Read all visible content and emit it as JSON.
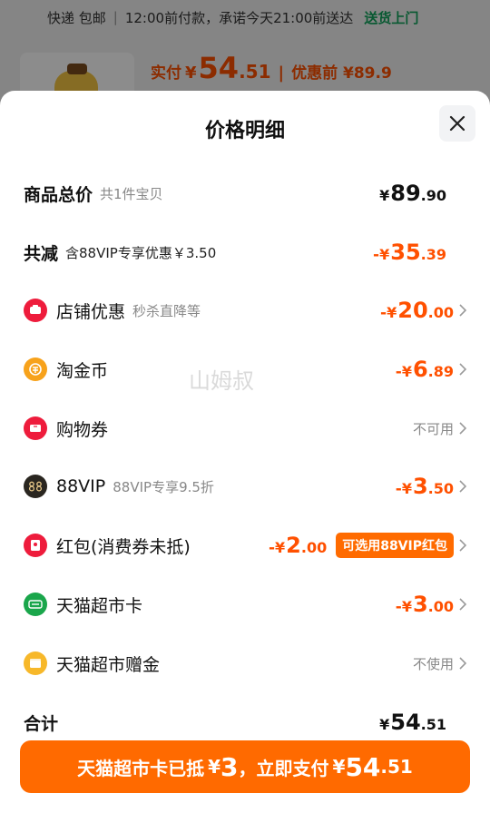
{
  "background": {
    "delivery_prefix": "快递 包邮",
    "delivery_info": "12:00前付款，承诺今天21:00前送达",
    "delivery_link": "送货上门",
    "paid_label": "实付",
    "paid_currency": "¥",
    "paid_int": "54",
    "paid_dec": ".51",
    "before_label": "优惠前 ¥89.9"
  },
  "sheet": {
    "title": "价格明细",
    "watermark": "山姆叔"
  },
  "rows": {
    "total": {
      "label": "商品总价",
      "sub": "共1件宝贝",
      "currency": "¥",
      "int": "89",
      "dec": ".90"
    },
    "reduce": {
      "label": "共减",
      "sub": "含88VIP专享优惠￥3.50",
      "sign": "-",
      "currency": "¥",
      "int": "35",
      "dec": ".39"
    },
    "shop": {
      "label": "店铺优惠",
      "sub": "秒杀直降等",
      "sign": "-",
      "currency": "¥",
      "int": "20",
      "dec": ".00"
    },
    "coins": {
      "label": "淘金币",
      "sign": "-",
      "currency": "¥",
      "int": "6",
      "dec": ".89"
    },
    "voucher": {
      "label": "购物券",
      "status": "不可用"
    },
    "vip": {
      "label": "88VIP",
      "sub": "88VIP专享9.5折",
      "sign": "-",
      "currency": "¥",
      "int": "3",
      "dec": ".50"
    },
    "redpacket": {
      "label": "红包(消费券未抵)",
      "sign": "-",
      "currency": "¥",
      "int": "2",
      "dec": ".00",
      "tag": "可选用88VIP红包"
    },
    "market_card": {
      "label": "天猫超市卡",
      "sign": "-",
      "currency": "¥",
      "int": "3",
      "dec": ".00"
    },
    "market_gift": {
      "label": "天猫超市赠金",
      "status": "不使用"
    },
    "sum": {
      "label": "合计",
      "currency": "¥",
      "int": "54",
      "dec": ".51"
    }
  },
  "pay_button": {
    "text": "天猫超市卡已抵",
    "deduct_currency": "¥",
    "deduct_amount": "3",
    "text2": "，立即支付",
    "currency": "¥",
    "int": "54",
    "dec": ".51"
  },
  "colors": {
    "accent": "#ff5000",
    "button": "#ff6a00",
    "green": "#11a35b"
  },
  "icons": {
    "shop": "shop-coupon-icon",
    "coins": "gold-coin-icon",
    "voucher": "voucher-ticket-icon",
    "vip": "88vip-icon",
    "redpacket": "red-packet-icon",
    "market_card": "tmall-supermarket-card-icon",
    "market_gift": "gift-money-icon"
  }
}
